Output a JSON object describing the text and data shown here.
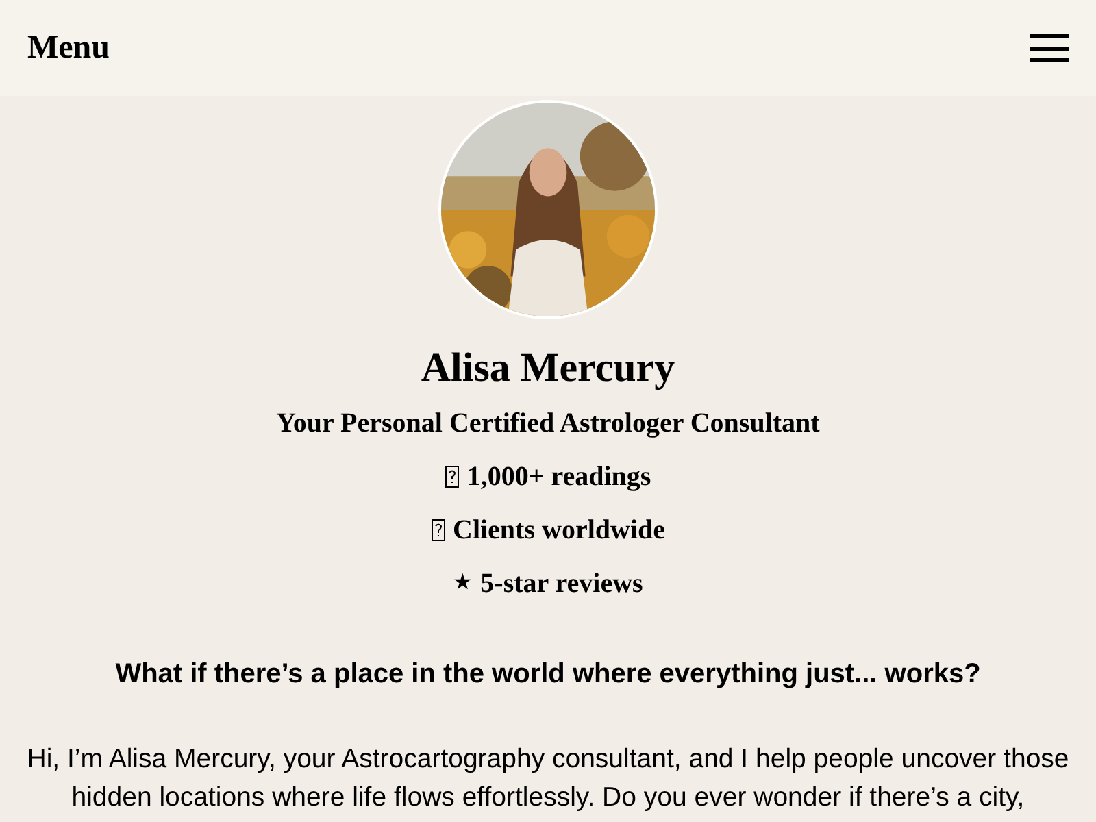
{
  "header": {
    "title": "Menu"
  },
  "profile": {
    "name": "Alisa Mercury",
    "subtitle": "Your Personal Certified Astrologer Consultant",
    "highlights": [
      {
        "kind": "missing_glyph",
        "text": "1,000+ readings"
      },
      {
        "kind": "missing_glyph",
        "text": "Clients worldwide"
      },
      {
        "kind": "glyph",
        "glyph": "★",
        "text": "5-star reviews"
      }
    ]
  },
  "intro": {
    "question": "What if there’s a place in the world where everything just... works?",
    "paragraph": "Hi, I’m Alisa Mercury, your Astrocartography consultant, and I help people uncover those hidden locations where life flows effortlessly. Do you ever wonder if there’s a city,"
  }
}
